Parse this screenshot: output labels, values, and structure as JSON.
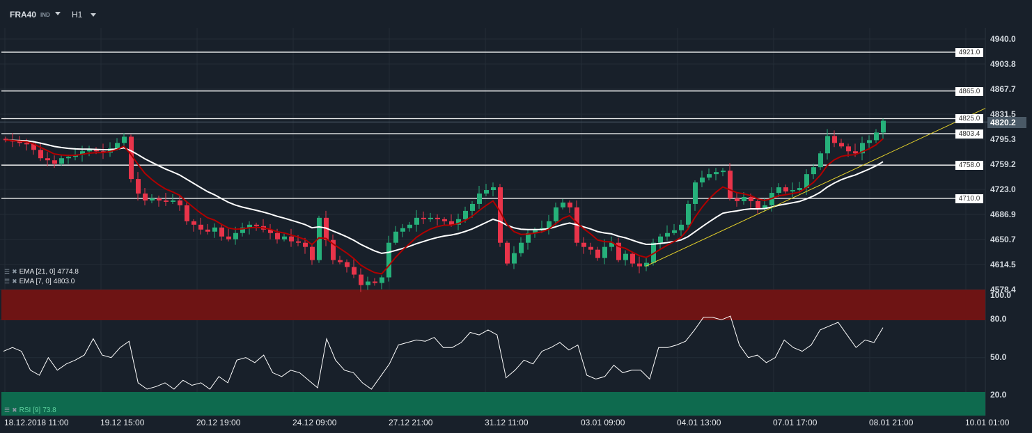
{
  "toolbar": {
    "symbol": "FRA40",
    "class": "IND",
    "timeframe": "H1"
  },
  "colors": {
    "up": "#26b07a",
    "down": "#e8344a",
    "ema7": "#b00000",
    "ema21": "#ffffff",
    "trend": "#e6d22a",
    "rsi_overbought": "#6e1414",
    "rsi_oversold": "#0e6a4e",
    "background": "#18202a"
  },
  "indicators": {
    "ema21": {
      "label": "EMA [21, 0]",
      "value": "4774.8",
      "period": 21
    },
    "ema7": {
      "label": "EMA [7, 0]",
      "value": "4803.0",
      "period": 7
    },
    "rsi": {
      "label": "RSI [9]",
      "value": "73.8"
    }
  },
  "price_axis": {
    "labels": [
      "4940.0",
      "4903.8",
      "4867.7",
      "4831.5",
      "4795.3",
      "4759.2",
      "4723.0",
      "4686.9",
      "4650.7",
      "4614.5",
      "4578.4"
    ],
    "range": [
      4578.4,
      4940.0
    ]
  },
  "current_price": "4820.2",
  "levels": [
    "4921.0",
    "4865.0",
    "4825.0",
    "4803.4",
    "4758.0",
    "4710.0"
  ],
  "rsi_axis": {
    "labels": [
      "100.0",
      "80.0",
      "50.0",
      "20.0"
    ],
    "overbought": 80,
    "oversold": 20
  },
  "time_axis": [
    "18.12.2018  11:00",
    "19.12  15:00",
    "20.12  19:00",
    "24.12  09:00",
    "27.12  21:00",
    "31.12  11:00",
    "03.01  09:00",
    "04.01  13:00",
    "07.01  17:00",
    "08.01  21:00",
    "10.01  01:00"
  ],
  "trendline": {
    "from_price": 4612,
    "to_price": 4840
  },
  "chart_data": {
    "type": "candlestick",
    "closes": [
      4794,
      4792,
      4790,
      4789,
      4780,
      4768,
      4765,
      4760,
      4768,
      4770,
      4773,
      4778,
      4780,
      4778,
      4776,
      4782,
      4790,
      4799,
      4738,
      4717,
      4707,
      4710,
      4707,
      4705,
      4707,
      4700,
      4677,
      4672,
      4665,
      4662,
      4668,
      4655,
      4651,
      4660,
      4668,
      4672,
      4670,
      4665,
      4660,
      4651,
      4655,
      4648,
      4646,
      4640,
      4621,
      4682,
      4650,
      4621,
      4618,
      4611,
      4600,
      4585,
      4590,
      4588,
      4596,
      4646,
      4662,
      4667,
      4672,
      4682,
      4680,
      4682,
      4680,
      4677,
      4672,
      4680,
      4692,
      4702,
      4717,
      4722,
      4726,
      4646,
      4616,
      4631,
      4646,
      4660,
      4664,
      4667,
      4677,
      4697,
      4704,
      4697,
      4646,
      4640,
      4636,
      4624,
      4640,
      4646,
      4621,
      4630,
      4616,
      4612,
      4617,
      4646,
      4655,
      4660,
      4664,
      4672,
      4702,
      4733,
      4740,
      4745,
      4748,
      4750,
      4710,
      4706,
      4712,
      4706,
      4695,
      4700,
      4718,
      4726,
      4720,
      4722,
      4725,
      4745,
      4755,
      4775,
      4800,
      4790,
      4785,
      4778,
      4775,
      4790,
      4794,
      4805,
      4822
    ],
    "rsi": [
      55,
      58,
      55,
      40,
      36,
      50,
      40,
      45,
      48,
      52,
      65,
      52,
      50,
      58,
      63,
      30,
      25,
      27,
      30,
      25,
      32,
      28,
      30,
      25,
      35,
      30,
      48,
      50,
      46,
      52,
      38,
      35,
      40,
      38,
      32,
      26,
      65,
      48,
      40,
      38,
      30,
      25,
      35,
      45,
      60,
      62,
      64,
      63,
      66,
      58,
      58,
      62,
      70,
      68,
      72,
      68,
      34,
      40,
      48,
      45,
      55,
      58,
      62,
      56,
      60,
      36,
      33,
      35,
      44,
      38,
      40,
      40,
      33,
      58,
      58,
      60,
      63,
      72,
      82,
      82,
      80,
      83,
      60,
      50,
      52,
      46,
      50,
      64,
      58,
      55,
      60,
      72,
      75,
      78,
      68,
      58,
      64,
      62,
      73.8
    ]
  }
}
